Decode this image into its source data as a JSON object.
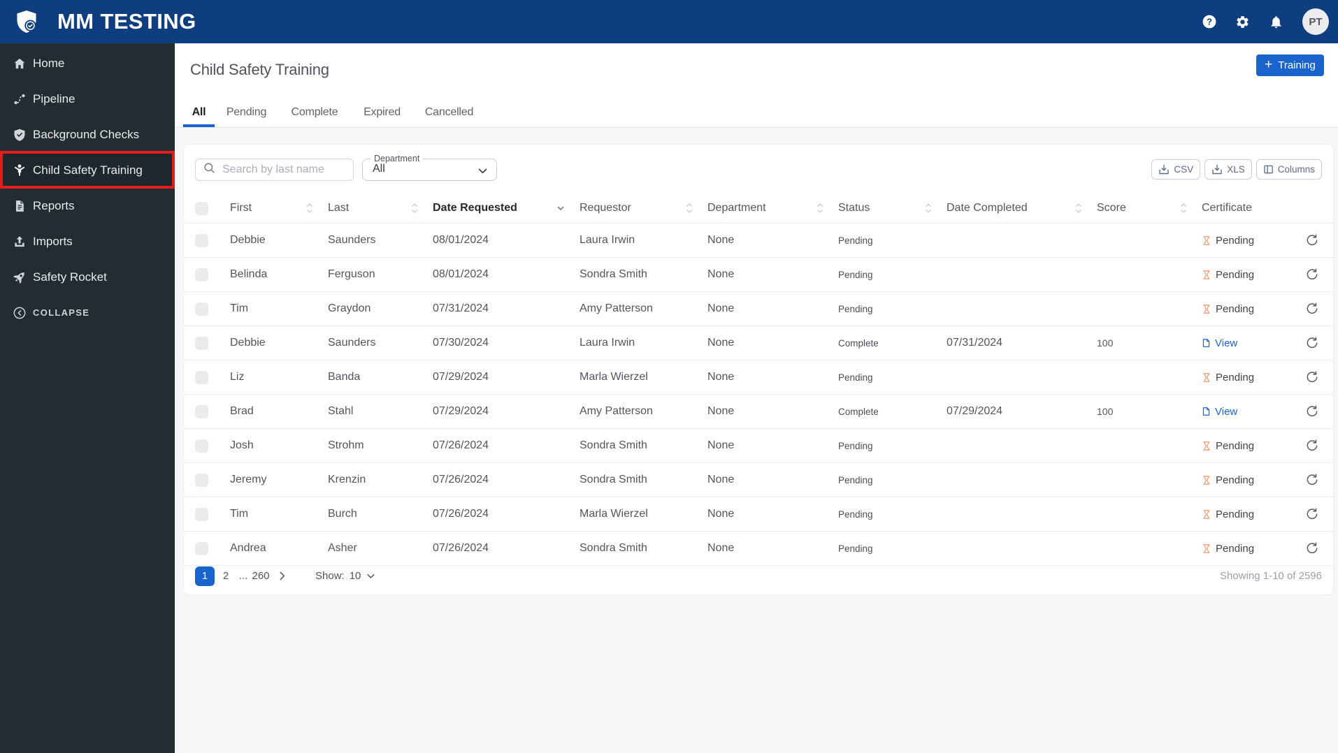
{
  "topbar": {
    "app_title": "MM TESTING",
    "avatar_initials": "PT"
  },
  "sidebar": {
    "items": [
      {
        "label": "Home",
        "icon": "home-icon"
      },
      {
        "label": "Pipeline",
        "icon": "pipeline-icon"
      },
      {
        "label": "Background Checks",
        "icon": "shield-check-icon"
      },
      {
        "label": "Child Safety Training",
        "icon": "child-icon",
        "active": true
      },
      {
        "label": "Reports",
        "icon": "report-icon"
      },
      {
        "label": "Imports",
        "icon": "upload-icon"
      },
      {
        "label": "Safety Rocket",
        "icon": "rocket-icon"
      }
    ],
    "collapse_label": "COLLAPSE"
  },
  "page": {
    "title": "Child Safety Training",
    "tabs": [
      "All",
      "Pending",
      "Complete",
      "Expired",
      "Cancelled"
    ],
    "active_tab": "All",
    "training_button": "Training"
  },
  "toolbar": {
    "search_placeholder": "Search by last name",
    "search_value": "",
    "department_label": "Department",
    "department_value": "All",
    "csv_button": "CSV",
    "xls_button": "XLS",
    "columns_button": "Columns"
  },
  "table": {
    "headers": [
      "First",
      "Last",
      "Date Requested",
      "Requestor",
      "Department",
      "Status",
      "Date Completed",
      "Score",
      "Certificate"
    ],
    "sorted_by": "Date Requested",
    "rows": [
      {
        "first": "Debbie",
        "last": "Saunders",
        "date_requested": "08/01/2024",
        "requestor": "Laura Irwin",
        "department": "None",
        "status": "Pending",
        "date_completed": "",
        "score": "",
        "cert_type": "pending",
        "cert_label": "Pending"
      },
      {
        "first": "Belinda",
        "last": "Ferguson",
        "date_requested": "08/01/2024",
        "requestor": "Sondra Smith",
        "department": "None",
        "status": "Pending",
        "date_completed": "",
        "score": "",
        "cert_type": "pending",
        "cert_label": "Pending"
      },
      {
        "first": "Tim",
        "last": "Graydon",
        "date_requested": "07/31/2024",
        "requestor": "Amy Patterson",
        "department": "None",
        "status": "Pending",
        "date_completed": "",
        "score": "",
        "cert_type": "pending",
        "cert_label": "Pending"
      },
      {
        "first": "Debbie",
        "last": "Saunders",
        "date_requested": "07/30/2024",
        "requestor": "Laura Irwin",
        "department": "None",
        "status": "Complete",
        "date_completed": "07/31/2024",
        "score": "100",
        "cert_type": "view",
        "cert_label": "View"
      },
      {
        "first": "Liz",
        "last": "Banda",
        "date_requested": "07/29/2024",
        "requestor": "Marla Wierzel",
        "department": "None",
        "status": "Pending",
        "date_completed": "",
        "score": "",
        "cert_type": "pending",
        "cert_label": "Pending"
      },
      {
        "first": "Brad",
        "last": "Stahl",
        "date_requested": "07/29/2024",
        "requestor": "Amy Patterson",
        "department": "None",
        "status": "Complete",
        "date_completed": "07/29/2024",
        "score": "100",
        "cert_type": "view",
        "cert_label": "View"
      },
      {
        "first": "Josh",
        "last": "Strohm",
        "date_requested": "07/26/2024",
        "requestor": "Sondra Smith",
        "department": "None",
        "status": "Pending",
        "date_completed": "",
        "score": "",
        "cert_type": "pending",
        "cert_label": "Pending"
      },
      {
        "first": "Jeremy",
        "last": "Krenzin",
        "date_requested": "07/26/2024",
        "requestor": "Sondra Smith",
        "department": "None",
        "status": "Pending",
        "date_completed": "",
        "score": "",
        "cert_type": "pending",
        "cert_label": "Pending"
      },
      {
        "first": "Tim",
        "last": "Burch",
        "date_requested": "07/26/2024",
        "requestor": "Marla Wierzel",
        "department": "None",
        "status": "Pending",
        "date_completed": "",
        "score": "",
        "cert_type": "pending",
        "cert_label": "Pending"
      },
      {
        "first": "Andrea",
        "last": "Asher",
        "date_requested": "07/26/2024",
        "requestor": "Sondra Smith",
        "department": "None",
        "status": "Pending",
        "date_completed": "",
        "score": "",
        "cert_type": "pending",
        "cert_label": "Pending"
      }
    ]
  },
  "pagination": {
    "pages": [
      "1",
      "2",
      "260"
    ],
    "current_page": "1",
    "ellipsis": "...",
    "show_label": "Show:",
    "show_value": "10",
    "summary": "Showing 1-10 of 2596"
  },
  "colors": {
    "topbar": "#0f3e80",
    "sidebar": "#222d32",
    "accent": "#1863cc",
    "highlight_red": "#e61b1b",
    "pending_orange": "#ee9e74"
  }
}
